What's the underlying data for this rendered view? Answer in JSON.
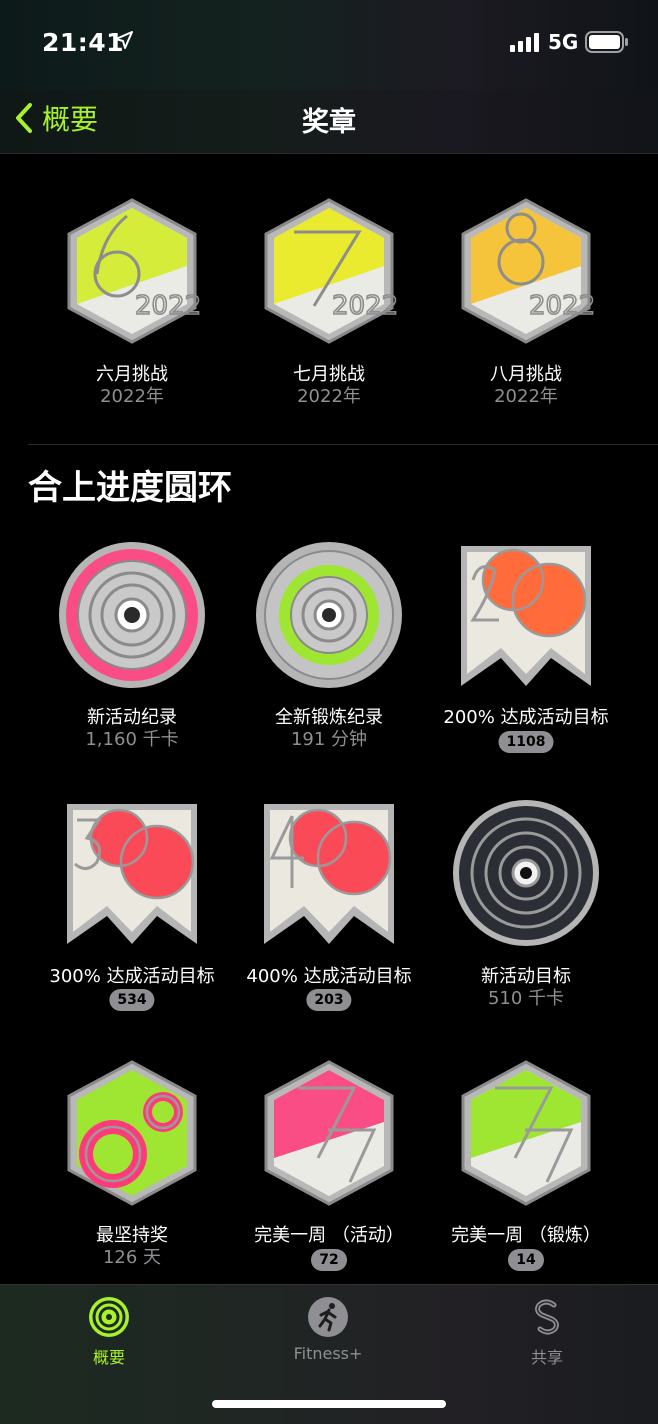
{
  "status": {
    "time": "21:41",
    "network": "5G"
  },
  "nav": {
    "back_label": "概要",
    "title": "奖章"
  },
  "monthly_badges": [
    {
      "title": "六月挑战",
      "year": "2022年",
      "color": "#d6ec3a"
    },
    {
      "title": "七月挑战",
      "year": "2022年",
      "color": "#eaea2e"
    },
    {
      "title": "八月挑战",
      "year": "2022年",
      "color": "#f5c43a"
    }
  ],
  "section": {
    "title": "合上进度圆环"
  },
  "ring_badges": [
    {
      "title": "新活动纪录",
      "sub": "1,160 千卡",
      "count": ""
    },
    {
      "title": "全新锻炼纪录",
      "sub": "191 分钟",
      "count": ""
    },
    {
      "title": "200% 达成活动目标",
      "sub": "",
      "count": "1108"
    },
    {
      "title": "300% 达成活动目标",
      "sub": "",
      "count": "534"
    },
    {
      "title": "400% 达成活动目标",
      "sub": "",
      "count": "203"
    },
    {
      "title": "新活动目标",
      "sub": "510 千卡",
      "count": ""
    },
    {
      "title": "最坚持奖",
      "sub": "126 天",
      "count": ""
    },
    {
      "title": "完美一周 （活动）",
      "sub": "",
      "count": "72"
    },
    {
      "title": "完美一周 （锻炼）",
      "sub": "",
      "count": "14"
    }
  ],
  "tabs": [
    {
      "label": "概要",
      "icon": "activity-rings-icon",
      "active": true
    },
    {
      "label": "Fitness+",
      "icon": "runner-icon",
      "active": false
    },
    {
      "label": "共享",
      "icon": "share-s-icon",
      "active": false
    }
  ],
  "colors": {
    "accent": "#a8f22c",
    "move": "#fa2e6c",
    "exercise": "#9ee632",
    "secondary_text": "#8e8e93"
  }
}
